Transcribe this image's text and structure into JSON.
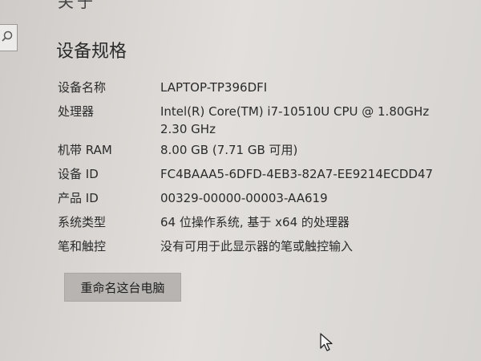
{
  "window": {
    "top_cut_title": "关于",
    "section_title": "设备规格"
  },
  "specs": [
    {
      "label": "设备名称",
      "value": "LAPTOP-TP396DFI"
    },
    {
      "label": "处理器",
      "value": "Intel(R) Core(TM) i7-10510U CPU @ 1.80GHz   2.30 GHz"
    },
    {
      "label": "机带 RAM",
      "value": "8.00 GB (7.71 GB 可用)"
    },
    {
      "label": "设备 ID",
      "value": "FC4BAAA5-6DFD-4EB3-82A7-EE9214ECDD47"
    },
    {
      "label": "产品 ID",
      "value": "00329-00000-00003-AA619"
    },
    {
      "label": "系统类型",
      "value": "64 位操作系统, 基于 x64 的处理器"
    },
    {
      "label": "笔和触控",
      "value": "没有可用于此显示器的笔或触控输入"
    }
  ],
  "actions": {
    "rename_label": "重命名这台电脑"
  },
  "icons": {
    "search": "search-icon",
    "cursor": "mouse-cursor-icon"
  },
  "colors": {
    "background": "#d9d6d3",
    "button": "#b7b4b1",
    "text": "#2b2b2b"
  }
}
